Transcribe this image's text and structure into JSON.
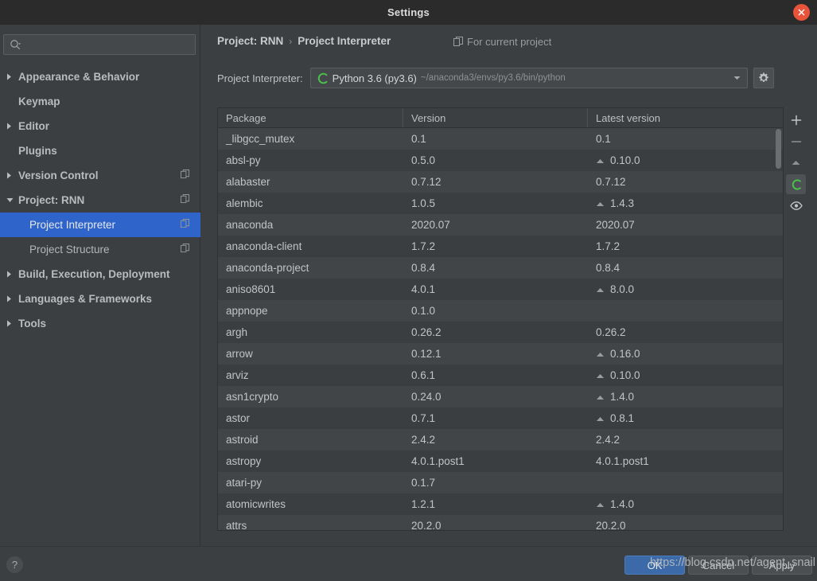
{
  "window": {
    "title": "Settings",
    "close_icon": "close-icon",
    "accent_close": "#e8533a"
  },
  "search": {
    "placeholder": "",
    "value": "",
    "icon": "search-icon"
  },
  "sidebar": {
    "items": [
      {
        "label": "Appearance & Behavior",
        "expandable": true,
        "expanded": false,
        "child": false,
        "selected": false,
        "copy_icon": false
      },
      {
        "label": "Keymap",
        "expandable": false,
        "expanded": false,
        "child": false,
        "selected": false,
        "copy_icon": false
      },
      {
        "label": "Editor",
        "expandable": true,
        "expanded": false,
        "child": false,
        "selected": false,
        "copy_icon": false
      },
      {
        "label": "Plugins",
        "expandable": false,
        "expanded": false,
        "child": false,
        "selected": false,
        "copy_icon": false
      },
      {
        "label": "Version Control",
        "expandable": true,
        "expanded": false,
        "child": false,
        "selected": false,
        "copy_icon": true
      },
      {
        "label": "Project: RNN",
        "expandable": true,
        "expanded": true,
        "child": false,
        "selected": false,
        "copy_icon": true
      },
      {
        "label": "Project Interpreter",
        "expandable": false,
        "expanded": false,
        "child": true,
        "selected": true,
        "copy_icon": true
      },
      {
        "label": "Project Structure",
        "expandable": false,
        "expanded": false,
        "child": true,
        "selected": false,
        "copy_icon": true
      },
      {
        "label": "Build, Execution, Deployment",
        "expandable": true,
        "expanded": false,
        "child": false,
        "selected": false,
        "copy_icon": false
      },
      {
        "label": "Languages & Frameworks",
        "expandable": true,
        "expanded": false,
        "child": false,
        "selected": false,
        "copy_icon": false
      },
      {
        "label": "Tools",
        "expandable": true,
        "expanded": false,
        "child": false,
        "selected": false,
        "copy_icon": false
      }
    ]
  },
  "breadcrumb": {
    "project": "Project: RNN",
    "separator": "›",
    "page": "Project Interpreter"
  },
  "scope": {
    "label": "For current project",
    "icon": "copy-scope-icon"
  },
  "interpreter": {
    "label": "Project Interpreter:",
    "icon": "python-env-icon",
    "name": "Python 3.6 (py3.6)",
    "path": "~/anaconda3/envs/py3.6/bin/python",
    "dropdown_icon": "chevron-down-icon",
    "settings_icon": "gear-icon"
  },
  "packages_toolbar": {
    "add": "+",
    "remove": "−",
    "upgrade_icon": "upgrade-triangle-icon",
    "refresh_icon": "refresh-circle-icon",
    "show_early_icon": "eye-icon",
    "refresh_color": "#49c14b"
  },
  "packages_table": {
    "columns": [
      "Package",
      "Version",
      "Latest version"
    ],
    "rows": [
      {
        "package": "_libgcc_mutex",
        "version": "0.1",
        "latest": "0.1",
        "upgrade": false
      },
      {
        "package": "absl-py",
        "version": "0.5.0",
        "latest": "0.10.0",
        "upgrade": true
      },
      {
        "package": "alabaster",
        "version": "0.7.12",
        "latest": "0.7.12",
        "upgrade": false
      },
      {
        "package": "alembic",
        "version": "1.0.5",
        "latest": "1.4.3",
        "upgrade": true
      },
      {
        "package": "anaconda",
        "version": "2020.07",
        "latest": "2020.07",
        "upgrade": false
      },
      {
        "package": "anaconda-client",
        "version": "1.7.2",
        "latest": "1.7.2",
        "upgrade": false
      },
      {
        "package": "anaconda-project",
        "version": "0.8.4",
        "latest": "0.8.4",
        "upgrade": false
      },
      {
        "package": "aniso8601",
        "version": "4.0.1",
        "latest": "8.0.0",
        "upgrade": true
      },
      {
        "package": "appnope",
        "version": "0.1.0",
        "latest": "",
        "upgrade": false
      },
      {
        "package": "argh",
        "version": "0.26.2",
        "latest": "0.26.2",
        "upgrade": false
      },
      {
        "package": "arrow",
        "version": "0.12.1",
        "latest": "0.16.0",
        "upgrade": true
      },
      {
        "package": "arviz",
        "version": "0.6.1",
        "latest": "0.10.0",
        "upgrade": true
      },
      {
        "package": "asn1crypto",
        "version": "0.24.0",
        "latest": "1.4.0",
        "upgrade": true
      },
      {
        "package": "astor",
        "version": "0.7.1",
        "latest": "0.8.1",
        "upgrade": true
      },
      {
        "package": "astroid",
        "version": "2.4.2",
        "latest": "2.4.2",
        "upgrade": false
      },
      {
        "package": "astropy",
        "version": "4.0.1.post1",
        "latest": "4.0.1.post1",
        "upgrade": false
      },
      {
        "package": "atari-py",
        "version": "0.1.7",
        "latest": "",
        "upgrade": false
      },
      {
        "package": "atomicwrites",
        "version": "1.2.1",
        "latest": "1.4.0",
        "upgrade": true
      },
      {
        "package": "attrs",
        "version": "20.2.0",
        "latest": "20.2.0",
        "upgrade": false
      }
    ]
  },
  "footer": {
    "help_label": "?",
    "ok": "OK",
    "cancel": "Cancel",
    "apply": "Apply"
  },
  "watermark": {
    "text": "https://blog.csdn.net/agent_snail"
  }
}
